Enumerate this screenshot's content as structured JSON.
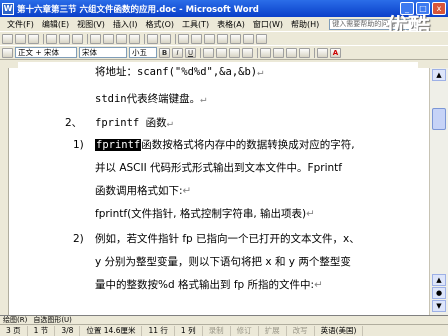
{
  "titlebar": {
    "title": "第十六章第三节 六组文件函数的应用.doc - Microsoft Word",
    "app_letter": "W",
    "minimize": "_",
    "maximize": "□",
    "close": "x"
  },
  "logo": "优酷",
  "menu": {
    "items": [
      "文件(F)",
      "编辑(E)",
      "视图(V)",
      "插入(I)",
      "格式(O)",
      "工具(T)",
      "表格(A)",
      "窗口(W)",
      "帮助(H)"
    ],
    "help_placeholder": "键入需要帮助的问题"
  },
  "toolbar2": {
    "style": "正文 + 宋体",
    "font": "宋体",
    "size": "小五",
    "bold": "B",
    "italic": "I",
    "underline": "U",
    "font_color": "A"
  },
  "doc": {
    "line1": "将地址：scanf(\"%d%d\",&a,&b)",
    "line2": "stdin代表终端键盘。",
    "heading_num": "2、",
    "heading_text": "fprintf 函数",
    "item1_num": "1)",
    "item1_hl": "fprintf",
    "item1_rest": "函数按格式将内存中的数据转换成对应的字符,",
    "item1_line2": "并以 ASCII 代码形式形式输出到文本文件中。Fprintf",
    "item1_line3": "函数调用格式如下:",
    "item1_line4": "fprintf(文件指针, 格式控制字符串, 输出项表)",
    "item2_num": "2)",
    "item2_line1": "例如，若文件指针 fp 已指向一个已打开的文本文件，x、",
    "item2_line2": "y 分别为整型变量，则以下语句将把 x 和 y 两个整型变",
    "item2_line3": "量中的整数按%d 格式输出到 fp 所指的文件中:",
    "para_mark": "↵"
  },
  "drawbar": {
    "draw": "绘图(R)",
    "autoshapes": "自选图形(U)"
  },
  "status": {
    "page": "3 页",
    "section": "1 节",
    "page_of": "3/8",
    "position": "位置 14.6厘米",
    "line": "11 行",
    "col": "1 列",
    "rec": "录制",
    "trk": "修订",
    "ext": "扩展",
    "ovr": "改写",
    "lang": "英语(美国)"
  }
}
